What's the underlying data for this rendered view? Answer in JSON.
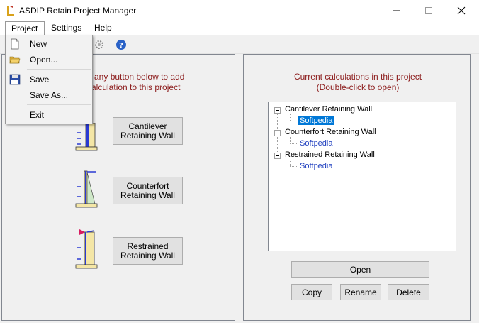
{
  "window": {
    "title": "ASDIP Retain Project Manager",
    "controls": [
      "minimize",
      "maximize",
      "close"
    ]
  },
  "menubar": {
    "items": [
      {
        "label": "Project",
        "open": true
      },
      {
        "label": "Settings"
      },
      {
        "label": "Help"
      }
    ]
  },
  "project_menu": {
    "items": [
      {
        "label": "New",
        "icon": "new-file-icon"
      },
      {
        "label": "Open...",
        "icon": "open-folder-icon"
      },
      {
        "label": "Save",
        "icon": "save-disk-icon"
      },
      {
        "label": "Save As..."
      },
      {
        "label": "Exit"
      }
    ]
  },
  "toolbar": {
    "icons": [
      "new-file-icon",
      "settings-icon",
      "help-icon"
    ]
  },
  "left_panel": {
    "instruction_line1": "n any button below to add",
    "instruction_line2": "calculation to this project",
    "buttons": [
      {
        "line1": "Cantilever",
        "line2": "Retaining Wall",
        "icon": "cantilever-wall-icon"
      },
      {
        "line1": "Counterfort",
        "line2": "Retaining Wall",
        "icon": "counterfort-wall-icon"
      },
      {
        "line1": "Restrained",
        "line2": "Retaining Wall",
        "icon": "restrained-wall-icon"
      }
    ]
  },
  "right_panel": {
    "instruction_line1": "Current calculations in this project",
    "instruction_line2": "(Double-click to open)",
    "tree": [
      {
        "label": "Cantilever Retaining Wall",
        "expanded": true,
        "children": [
          {
            "label": "Softpedia",
            "selected": true
          }
        ]
      },
      {
        "label": "Counterfort Retaining Wall",
        "expanded": true,
        "children": [
          {
            "label": "Softpedia",
            "selected": false
          }
        ]
      },
      {
        "label": "Restrained Retaining Wall",
        "expanded": true,
        "children": [
          {
            "label": "Softpedia",
            "selected": false
          }
        ]
      }
    ],
    "buttons": {
      "open": "Open",
      "copy": "Copy",
      "rename": "Rename",
      "delete": "Delete"
    }
  },
  "colors": {
    "instruction_text": "#8b1a1a",
    "tree_child_text": "#1f3fbf",
    "selection": "#0078d7"
  }
}
